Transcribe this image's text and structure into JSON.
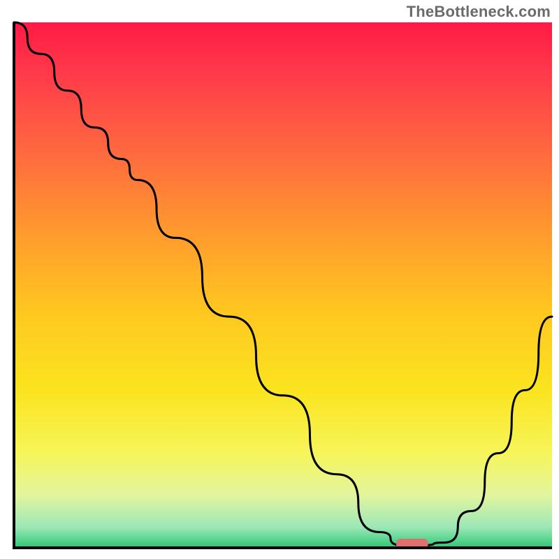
{
  "watermark": "TheBottleneck.com",
  "chart_data": {
    "type": "line",
    "title": "",
    "xlabel": "",
    "ylabel": "",
    "x": [
      0.0,
      0.05,
      0.1,
      0.15,
      0.2,
      0.23,
      0.3,
      0.4,
      0.5,
      0.6,
      0.68,
      0.72,
      0.76,
      0.8,
      0.85,
      0.9,
      0.95,
      1.0
    ],
    "values": [
      1.0,
      0.94,
      0.87,
      0.8,
      0.74,
      0.7,
      0.59,
      0.44,
      0.29,
      0.14,
      0.03,
      0.005,
      0.005,
      0.01,
      0.07,
      0.18,
      0.3,
      0.44
    ],
    "xlim": [
      0,
      1
    ],
    "ylim": [
      0,
      1
    ],
    "marker": {
      "x": 0.74,
      "y": 0.008,
      "color": "#e07070"
    },
    "background": {
      "gradient_stops": [
        {
          "offset": 0.0,
          "color": "#ff1a45"
        },
        {
          "offset": 0.1,
          "color": "#ff3b4a"
        },
        {
          "offset": 0.25,
          "color": "#ff6a3f"
        },
        {
          "offset": 0.4,
          "color": "#ff9a2e"
        },
        {
          "offset": 0.55,
          "color": "#ffc720"
        },
        {
          "offset": 0.7,
          "color": "#fbe41f"
        },
        {
          "offset": 0.82,
          "color": "#f7f55a"
        },
        {
          "offset": 0.9,
          "color": "#e2f59e"
        },
        {
          "offset": 0.96,
          "color": "#9de8b7"
        },
        {
          "offset": 1.0,
          "color": "#2fc776"
        }
      ]
    },
    "axis_color": "#000000",
    "line_color": "#000000"
  }
}
